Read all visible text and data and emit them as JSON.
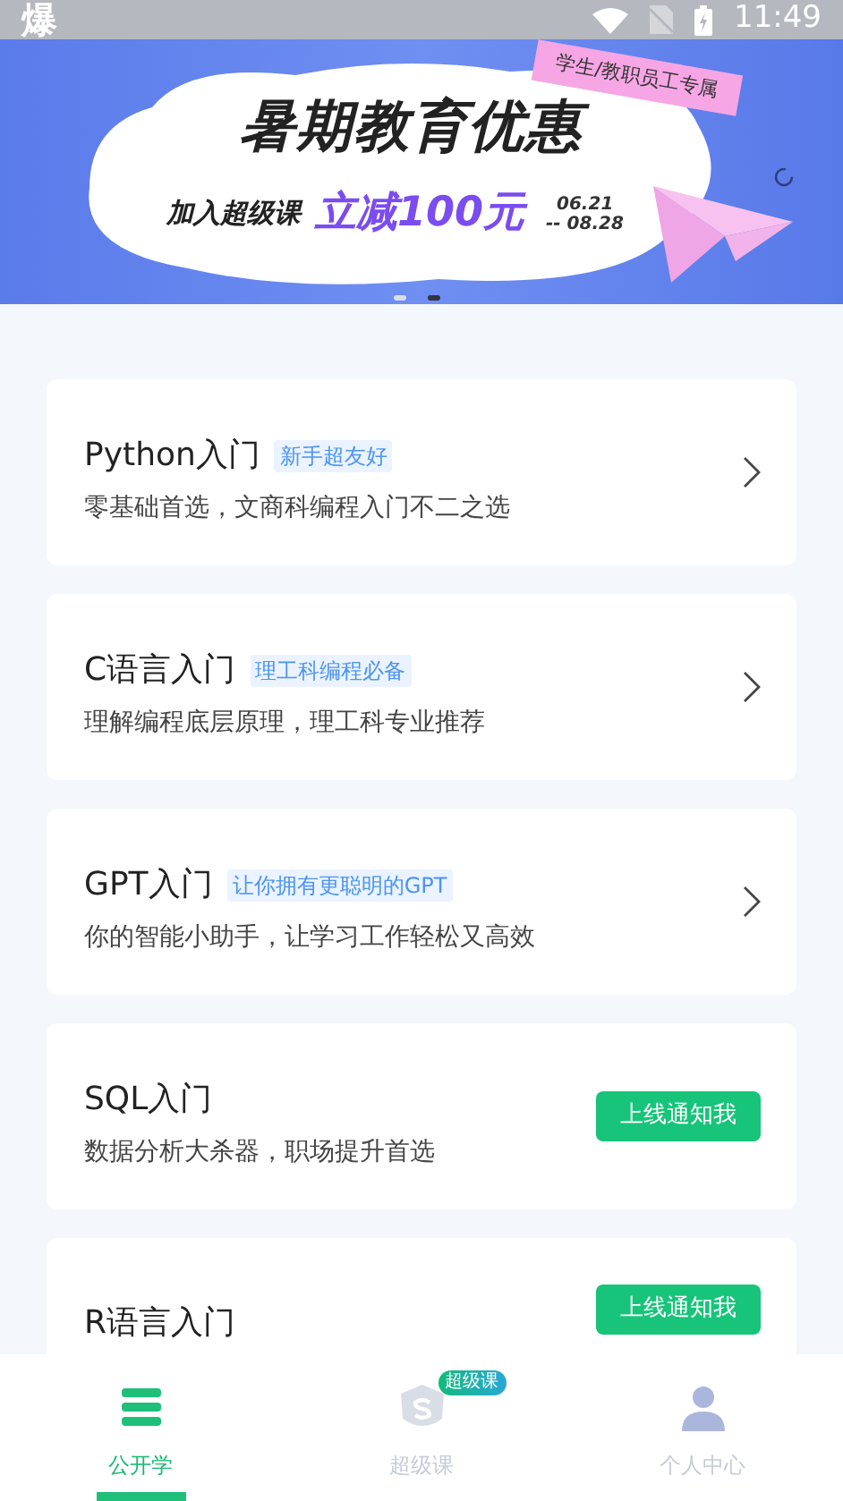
{
  "status_bar": {
    "app_glyph": "爆",
    "time": "11:49"
  },
  "banner": {
    "tag": "学生/教职员工专属",
    "title": "暑期教育优惠",
    "prefix": "加入超级课",
    "highlight": "立减100元",
    "date_start": "06.21",
    "date_end": "-- 08.28",
    "dots": [
      {
        "selected": false
      },
      {
        "selected": true
      }
    ]
  },
  "courses": [
    {
      "kind": "arrow",
      "title": "Python入门",
      "tag": "新手超友好",
      "subtitle": "零基础首选，文商科编程入门不二之选"
    },
    {
      "kind": "arrow",
      "title": "C语言入门",
      "tag": "理工科编程必备",
      "subtitle": "理解编程底层原理，理工科专业推荐"
    },
    {
      "kind": "arrow",
      "title": "GPT入门",
      "tag": "让你拥有更聪明的GPT",
      "subtitle": "你的智能小助手，让学习工作轻松又高效"
    },
    {
      "kind": "notify",
      "title": "SQL入门",
      "subtitle": "数据分析大杀器，职场提升首选",
      "button": "上线通知我"
    },
    {
      "kind": "notify",
      "title": "R语言入门",
      "button": "上线通知我"
    }
  ],
  "bottom_nav": [
    {
      "kind": "list",
      "label": "公开学",
      "selected": true
    },
    {
      "kind": "super",
      "label": "超级课",
      "badge": "超级课",
      "selected": false
    },
    {
      "kind": "person",
      "label": "个人中心",
      "selected": false
    }
  ]
}
